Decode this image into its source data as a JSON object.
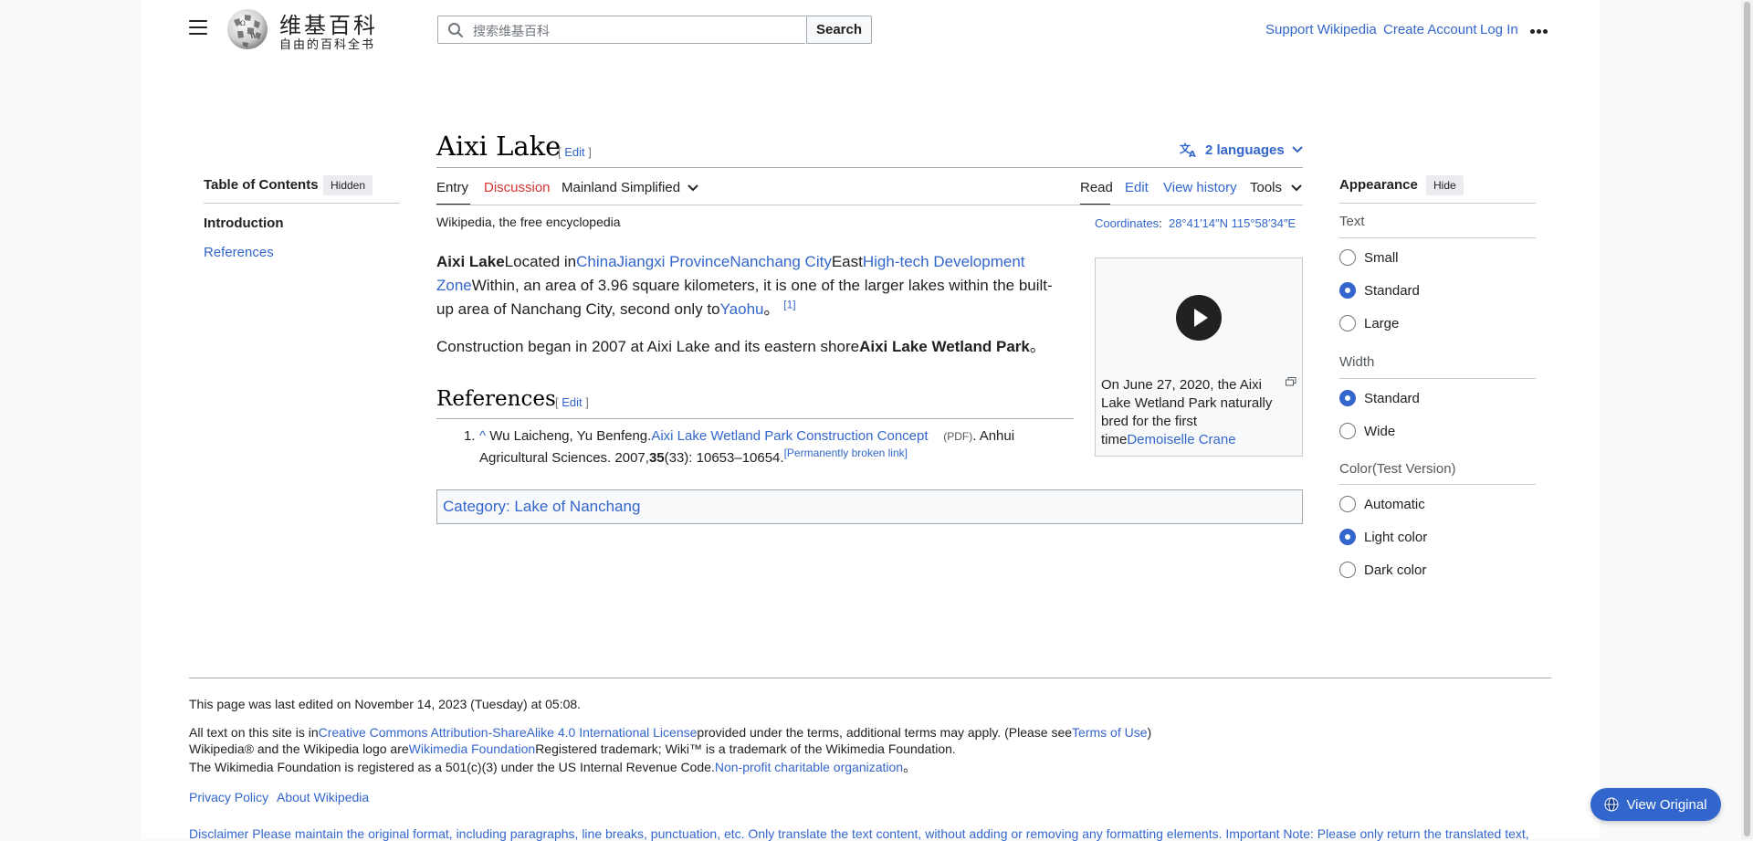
{
  "header": {
    "logo_title": "维基百科",
    "logo_tagline": "自由的百科全书",
    "search_placeholder": "搜索维基百科",
    "search_button": "Search",
    "support": "Support Wikipedia",
    "create_account": "Create Account",
    "login": "Log In",
    "more_icon": "ellipsis-icon"
  },
  "article": {
    "title": "Aixi Lake",
    "edit_label": "Edit",
    "languages": "2 languages",
    "tabs": {
      "entry": "Entry",
      "discussion": "Discussion",
      "variant": "Mainland Simplified",
      "read": "Read",
      "edit": "Edit",
      "history": "View history",
      "tools": "Tools"
    },
    "tagline": "Wikipedia, the free encyclopedia",
    "coordinates_label": "Coordinates",
    "coordinates_value": "28°41′14″N 115°58′34″E",
    "p1": {
      "bold": "Aixi Lake",
      "t1": "Located in",
      "l1": "China",
      "l2": "Jiangxi Province",
      "l3": "Nanchang City",
      "t2": "East",
      "l4": "High-tech Development Zone",
      "t3": "Within, an area of 3.96 square kilometers, it is one of the larger lakes within the built-up area of Nanchang City, second only to",
      "l5": "Yaohu",
      "t4": "。",
      "ref": "[1]"
    },
    "p2": {
      "t1": "Construction began in 2007 at Aixi Lake and its eastern shore",
      "bold": "Aixi Lake Wetland Park",
      "t2": "。"
    },
    "references_heading": "References",
    "ref1": {
      "number": "1.",
      "caret": "^",
      "authors": "Wu Laicheng, Yu Benfeng.",
      "link": "Aixi Lake Wetland Park Construction Concept",
      "pdf": "(PDF)",
      "journal": ". Anhui Agricultural Sciences. 2007,",
      "volume": "35",
      "pages": "(33): 10653–10654.",
      "dead": "[Permanently broken link]"
    },
    "category": "Category: Lake of Nanchang",
    "infobox": {
      "caption_text": "On June 27, 2020, the Aixi Lake Wetland Park naturally bred for the first time",
      "caption_link": "Demoiselle Crane"
    }
  },
  "toc": {
    "title": "Table of Contents",
    "toggle": "Hidden",
    "items": [
      "Introduction",
      "References"
    ]
  },
  "appearance": {
    "title": "Appearance",
    "toggle": "Hide",
    "text_label": "Text",
    "text_options": [
      "Small",
      "Standard",
      "Large"
    ],
    "text_selected": "Standard",
    "width_label": "Width",
    "width_options": [
      "Standard",
      "Wide"
    ],
    "width_selected": "Standard",
    "color_label": "Color(Test Version)",
    "color_options": [
      "Automatic",
      "Light color",
      "Dark color"
    ],
    "color_selected": "Light color"
  },
  "footer": {
    "last_edited": "This page was last edited on November 14, 2023 (Tuesday) at 05:08.",
    "license_pre": "All text on this site is in",
    "license_link": "Creative Commons Attribution-ShareAlike 4.0 International License",
    "license_post": "provided under the terms, additional terms may apply. (Please see",
    "terms_link": "Terms of Use",
    "license_end": ")",
    "trademark_pre": "Wikipedia® and the Wikipedia logo are",
    "trademark_link": "Wikimedia Foundation",
    "trademark_post": "Registered trademark; Wiki™ is a trademark of the Wikimedia Foundation.",
    "nonprofit_pre": "The Wikimedia Foundation is registered as a 501(c)(3) under the US Internal Revenue Code.",
    "nonprofit_link": "Non-profit charitable organization",
    "nonprofit_post": "。",
    "privacy": "Privacy Policy",
    "about": "About Wikipedia",
    "disclaimer": "Disclaimer Please maintain the original format, including paragraphs, line breaks, punctuation, etc. Only translate the text content, without adding or removing any formatting elements. Important Note: Please only return the translated text,"
  },
  "view_original": "View Original",
  "colors": {
    "link": "#3366cc",
    "discussion_red": "#d73333",
    "accent": "#3366cc"
  }
}
